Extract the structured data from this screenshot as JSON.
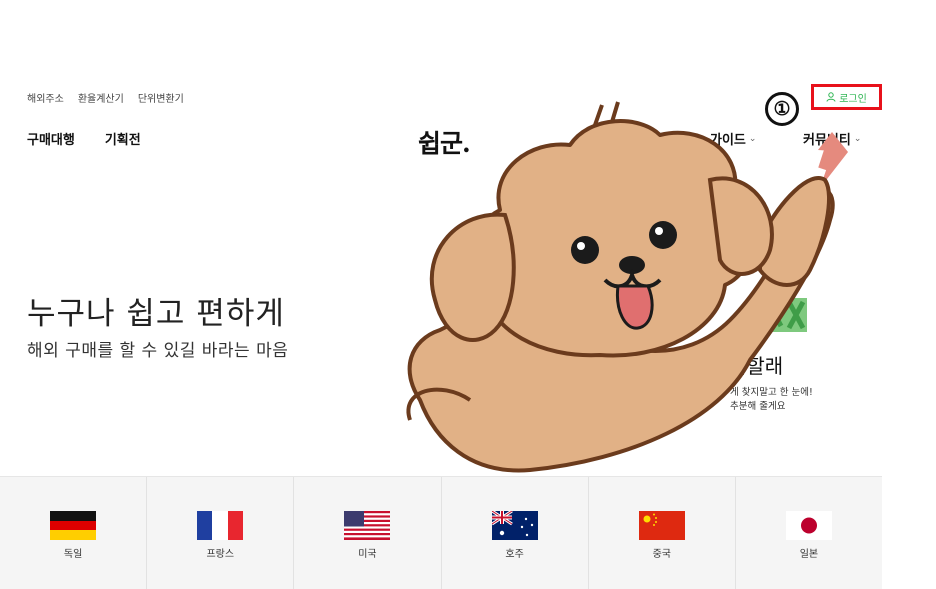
{
  "util_links": [
    "해외주소",
    "환율계산기",
    "단위변환기"
  ],
  "login": {
    "label": "로그인",
    "color": "#2fb553",
    "highlight_color": "#e8111b"
  },
  "step_marker": "①",
  "logo": "쉽군.",
  "gnb_left": [
    "구매대행",
    "기획전"
  ],
  "gnb_right": {
    "guide": "가이드",
    "community": "커뮤니티",
    "chevron": "⌄"
  },
  "hero": {
    "title": "누구나 쉽고 편하게",
    "subtitle": "해외 구매를 할 수 있길 바라는 마음"
  },
  "promo": {
    "heading": "거할래",
    "line1": "게 찾지말고 한 눈에!",
    "line2": "추분해 줄게요"
  },
  "countries": [
    {
      "name": "독일",
      "flag": "germany-flag-icon"
    },
    {
      "name": "프랑스",
      "flag": "france-flag-icon"
    },
    {
      "name": "미국",
      "flag": "usa-flag-icon"
    },
    {
      "name": "호주",
      "flag": "australia-flag-icon"
    },
    {
      "name": "중국",
      "flag": "china-flag-icon"
    },
    {
      "name": "일본",
      "flag": "japan-flag-icon"
    }
  ]
}
